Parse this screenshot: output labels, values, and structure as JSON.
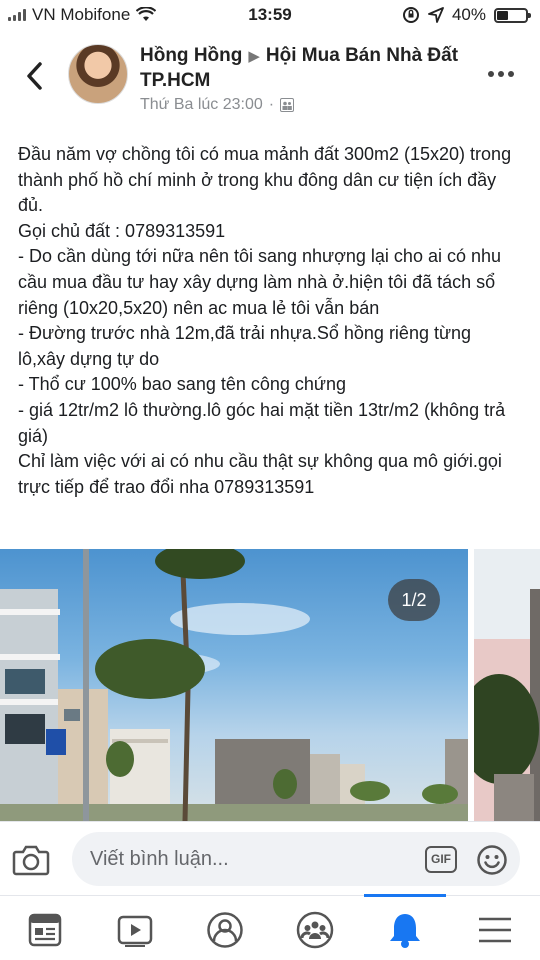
{
  "status_bar": {
    "carrier": "VN Mobifone",
    "time": "13:59",
    "battery": "40%",
    "battery_level": 0.4
  },
  "post": {
    "author": "Hồng Hồng",
    "group": "Hội Mua Bán Nhà Đất TP.HCM",
    "timestamp": "Thứ Ba lúc 23:00",
    "body": "Đầu năm vợ chồng tôi có mua mảnh đất 300m2 (15x20) trong thành phố hồ chí minh ở trong khu đông dân cư tiện ích đầy đủ.\nGọi chủ đất : 0789313591\n- Do cần dùng tới nữa nên tôi sang nhượng lại cho ai có nhu cầu mua đầu tư hay xây dựng làm nhà ở.hiện tôi đã tách sổ riêng (10x20,5x20) nên ac mua lẻ tôi vẫn bán\n- Đường trước nhà 12m,đã trải nhựa.Sổ hồng riêng từng lô,xây dựng tự do\n- Thổ cư 100% bao sang tên công chứng\n- giá 12tr/m2 lô thường.lô góc hai mặt tiền 13tr/m2 (không trả giá)\nChỉ làm việc với ai có nhu cầu thật sự không qua mô giới.gọi trực tiếp để trao đổi nha 0789313591",
    "photo_counter": "1/2"
  },
  "comment": {
    "placeholder": "Viết bình luận...",
    "gif_label": "GIF"
  },
  "icons": {
    "back": "chevron-left-icon",
    "more": "more-horizontal-icon",
    "camera": "camera-icon",
    "emoji": "smiley-icon",
    "globe": "group-privacy-icon",
    "tabs": [
      "news-feed-icon",
      "watch-icon",
      "profile-icon",
      "groups-icon",
      "notifications-bell-icon",
      "menu-icon"
    ]
  },
  "colors": {
    "accent": "#1877f2",
    "text": "#1c1e21",
    "muted": "#8a8d91"
  },
  "active_tab": "notifications"
}
